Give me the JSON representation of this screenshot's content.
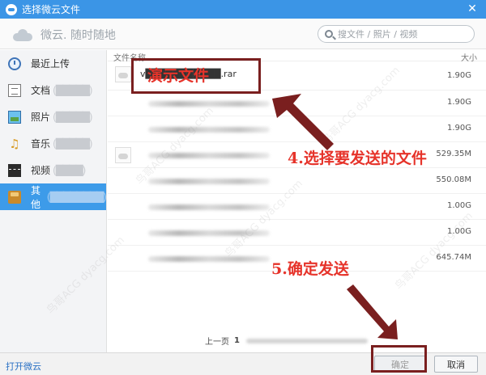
{
  "window": {
    "title": "选择微云文件",
    "close": "✕"
  },
  "header": {
    "brand": "微云. 随时随地",
    "search_placeholder": "搜文件 / 照片 / 视频"
  },
  "sidebar": {
    "items": [
      {
        "label": "最近上传",
        "suffix": "",
        "icon": "clock-icon"
      },
      {
        "label": "文档",
        "suffix": "(█████)",
        "icon": "document-icon"
      },
      {
        "label": "照片",
        "suffix": "(█████)",
        "icon": "image-icon"
      },
      {
        "label": "音乐",
        "suffix": "(█████)",
        "icon": "music-icon"
      },
      {
        "label": "视频",
        "suffix": "(████)",
        "icon": "video-icon"
      },
      {
        "label": "其他",
        "suffix": "(████████)",
        "icon": "folder-icon",
        "active": true
      }
    ]
  },
  "list": {
    "col_name": "文件名称",
    "col_size": "大小",
    "rows": [
      {
        "name": "v███████████.rar",
        "size": "1.90G"
      },
      {
        "name": "",
        "size": "1.90G"
      },
      {
        "name": "",
        "size": "1.90G"
      },
      {
        "name": "",
        "size": "529.35M"
      },
      {
        "name": "",
        "size": "550.08M"
      },
      {
        "name": "",
        "size": "1.00G"
      },
      {
        "name": "",
        "size": "1.00G"
      },
      {
        "name": "",
        "size": "645.74M"
      }
    ]
  },
  "pager": {
    "prev": "上一页",
    "current": "1"
  },
  "footer": {
    "open_link": "打开微云",
    "ok": "确定",
    "cancel": "取消"
  },
  "annotations": {
    "demo_file": "演示文件",
    "step4": "4.选择要发送的文件",
    "step5": "5.确定发送"
  },
  "watermark": "鸟哥ACG  dyacg.com",
  "colors": {
    "titlebar": "#3b95e6",
    "active_nav": "#3d9be9",
    "annotation": "#e6332a",
    "highlight": "#7a1f1f"
  }
}
